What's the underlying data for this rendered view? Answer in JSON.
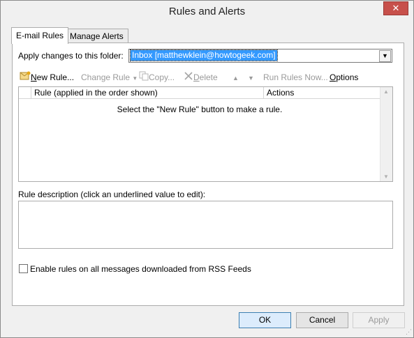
{
  "window": {
    "title": "Rules and Alerts",
    "close_glyph": "✕"
  },
  "tabs": [
    {
      "label": "E-mail Rules",
      "active": true
    },
    {
      "label": "Manage Alerts",
      "active": false
    }
  ],
  "folder": {
    "label": "Apply changes to this folder:",
    "value": "Inbox [matthewklein@howtogeek.com]"
  },
  "toolbar": {
    "new_rule": "New Rule...",
    "change_rule": "Change Rule",
    "copy": "Copy...",
    "delete": "Delete",
    "run_rules": "Run Rules Now...",
    "options": "Options"
  },
  "rules_list": {
    "columns": [
      "Rule (applied in the order shown)",
      "Actions"
    ],
    "empty_message": "Select the \"New Rule\" button to make a rule."
  },
  "description": {
    "label": "Rule description (click an underlined value to edit):"
  },
  "rss": {
    "label": "Enable rules on all messages downloaded from RSS Feeds",
    "checked": false
  },
  "buttons": {
    "ok": "OK",
    "cancel": "Cancel",
    "apply": "Apply"
  },
  "icons": {
    "close": "close-icon",
    "new_rule": "new-rule-icon",
    "change_rule_dropdown": "chevron-down-icon",
    "copy": "copy-icon",
    "delete": "delete-x-icon",
    "move_up": "arrow-up-icon",
    "move_down": "arrow-down-icon"
  }
}
